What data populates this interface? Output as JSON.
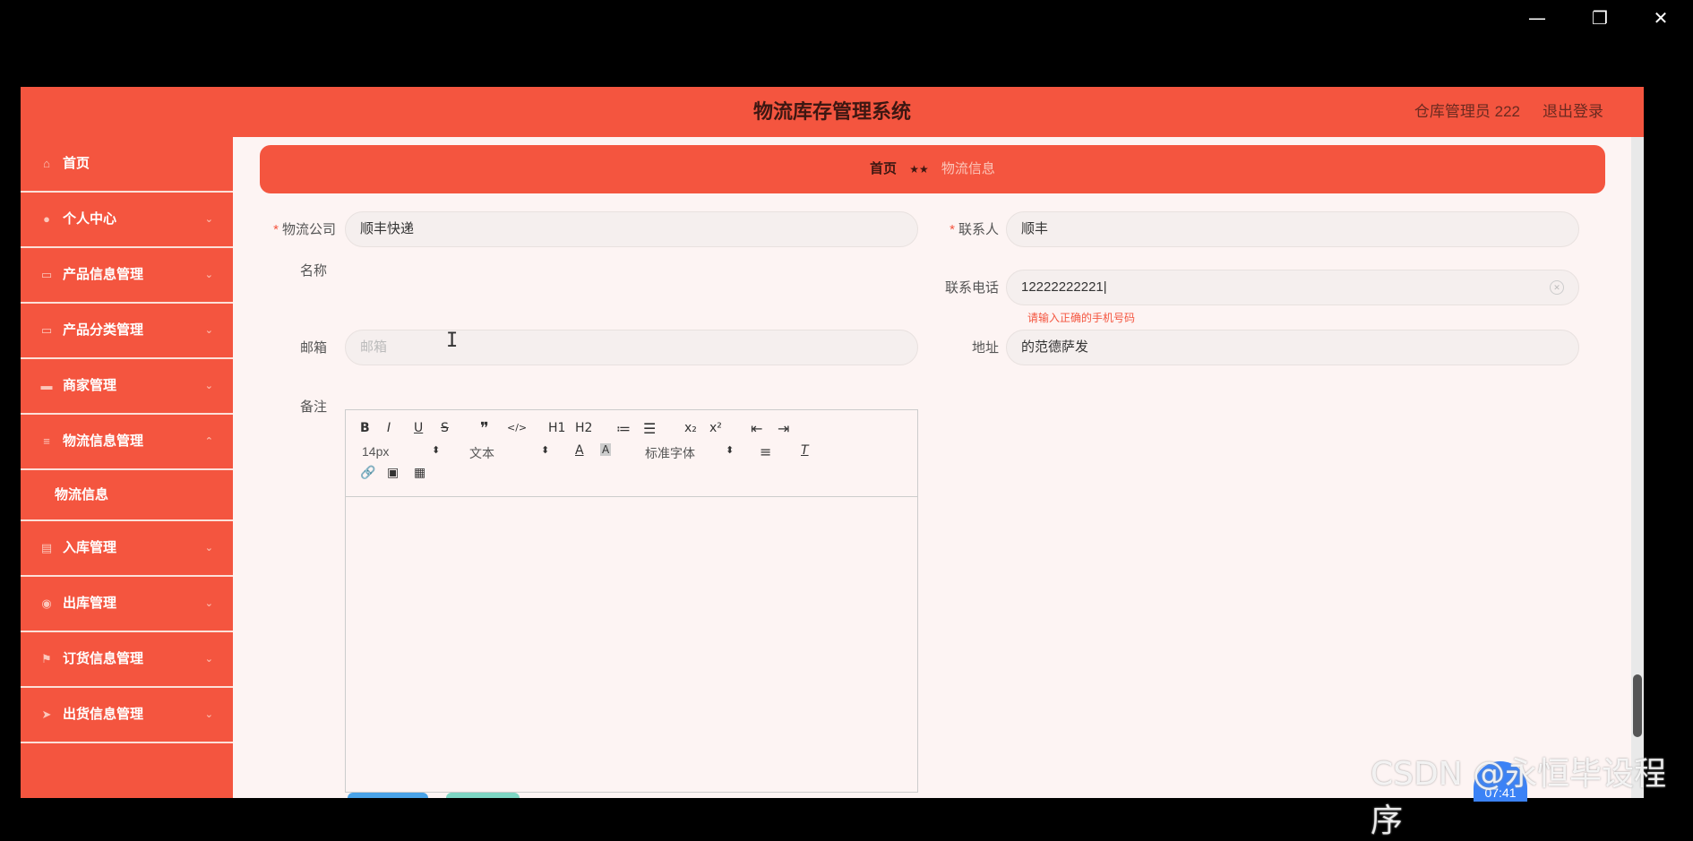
{
  "window": {
    "minimize": "—",
    "restore": "❐",
    "close": "✕"
  },
  "header": {
    "title": "物流库存管理系统",
    "user": "仓库管理员 222",
    "logout": "退出登录"
  },
  "sidebar": {
    "items": [
      {
        "label": "首页",
        "icon": "⌂",
        "arrow": ""
      },
      {
        "label": "个人中心",
        "icon": "●",
        "arrow": "⌄"
      },
      {
        "label": "产品信息管理",
        "icon": "▭",
        "arrow": "⌄"
      },
      {
        "label": "产品分类管理",
        "icon": "▭",
        "arrow": "⌄"
      },
      {
        "label": "商家管理",
        "icon": "▬",
        "arrow": "⌄"
      },
      {
        "label": "物流信息管理",
        "icon": "≡",
        "arrow": "⌃"
      }
    ],
    "submenu": {
      "label": "物流信息"
    },
    "items2": [
      {
        "label": "入库管理",
        "icon": "▤",
        "arrow": "⌄"
      },
      {
        "label": "出库管理",
        "icon": "◉",
        "arrow": "⌄"
      },
      {
        "label": "订货信息管理",
        "icon": "⚑",
        "arrow": "⌄"
      },
      {
        "label": "出货信息管理",
        "icon": "➤",
        "arrow": "⌄"
      }
    ]
  },
  "breadcrumb": {
    "home": "首页",
    "separator": "★★",
    "current": "物流信息"
  },
  "form": {
    "company_label": "物流公司",
    "company_label2": "名称",
    "company_value": "顺丰快递",
    "contact_label": "联系人",
    "contact_value": "顺丰",
    "phone_label": "联系电话",
    "phone_value": "12222222221",
    "phone_error": "请输入正确的手机号码",
    "email_label": "邮箱",
    "email_placeholder": "邮箱",
    "address_label": "地址",
    "address_value": "的范德萨发",
    "remark_label": "备注",
    "required_mark": "*"
  },
  "editor": {
    "font_size": "14px",
    "text_type": "文本",
    "font_family": "标准字体",
    "tools": [
      "B",
      "I",
      "U",
      "S",
      "❞",
      "</>",
      "H1",
      "H2",
      "≔",
      "☰",
      "x₂",
      "x²",
      "⇤",
      "⇥"
    ]
  },
  "overlay": {
    "watermark": "CSDN @永恒毕设程序",
    "time": "07:41"
  },
  "colors": {
    "primary": "#f4553f",
    "background": "#fdf4f3"
  }
}
